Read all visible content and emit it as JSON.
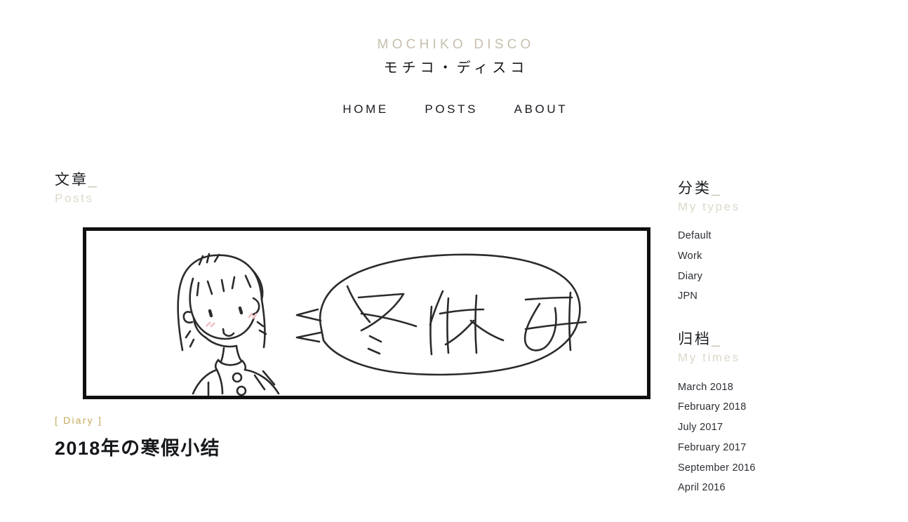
{
  "header": {
    "brand_en": "MOCHIKO DISCO",
    "brand_jp": "モチコ・ディスコ",
    "nav": [
      {
        "label": "HOME"
      },
      {
        "label": "POSTS"
      },
      {
        "label": "ABOUT"
      }
    ]
  },
  "posts_section": {
    "heading_cn": "文章",
    "heading_underscore": "_",
    "heading_en": "Posts",
    "post": {
      "category": "[ Diary ]",
      "title": "2018年の寒假小结",
      "image_alt": "hand-drawn girl with speech bubble",
      "image_bubble_text": "冬休み"
    }
  },
  "sidebar": {
    "categories": {
      "heading_cn": "分类",
      "heading_underscore": "_",
      "heading_en": "My types",
      "items": [
        {
          "label": "Default"
        },
        {
          "label": "Work"
        },
        {
          "label": "Diary"
        },
        {
          "label": "JPN"
        }
      ]
    },
    "archives": {
      "heading_cn": "归档",
      "heading_underscore": "_",
      "heading_en": "My times",
      "items": [
        {
          "label": "March 2018"
        },
        {
          "label": "February 2018"
        },
        {
          "label": "July 2017"
        },
        {
          "label": "February 2017"
        },
        {
          "label": "September 2016"
        },
        {
          "label": "April 2016"
        }
      ]
    }
  },
  "colors": {
    "brand_tan": "#c6bfae",
    "heading_light_tan": "#ddd8ca",
    "category_gold": "#c3ab5f",
    "text_dark": "#16181c",
    "frame_black": "#101010",
    "background": "#ffffff"
  }
}
